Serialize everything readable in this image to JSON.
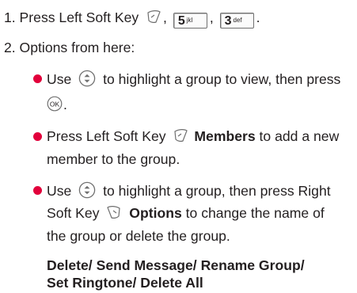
{
  "step1": {
    "prefix": "1. Press Left Soft Key",
    "comma1": ",",
    "comma2": ",",
    "end": ".",
    "key5_main": "5",
    "key5_sub": "jkl",
    "key3_main": "3",
    "key3_sub": "def"
  },
  "step2": {
    "text": "2. Options from here:"
  },
  "bullet1": {
    "line1": "Use",
    "line1b": "to highlight a group to view, then press",
    "line2_end": "."
  },
  "bullet2": {
    "line1_a": "Press Left Soft Key",
    "members": "Members",
    "line1_b": "to add  a  new",
    "line2": "member to the group."
  },
  "bullet3": {
    "line1_a": "Use",
    "line1_b": "to highlight a group, then press Right",
    "line2_a": "Soft Key",
    "options": "Options",
    "line2_b": "to change the name of",
    "line3": "the group or delete the group."
  },
  "options_list": {
    "line1": "Delete/ Send Message/ Rename Group/",
    "line2": "Set Ringtone/ Delete All"
  },
  "icons": {
    "left_soft_key": "left-soft-key-icon",
    "right_soft_key": "right-soft-key-icon",
    "nav_key": "nav-updown-icon",
    "ok_key": "ok-key-icon"
  },
  "colors": {
    "bullet": "#e2003b",
    "text": "#231f20"
  }
}
